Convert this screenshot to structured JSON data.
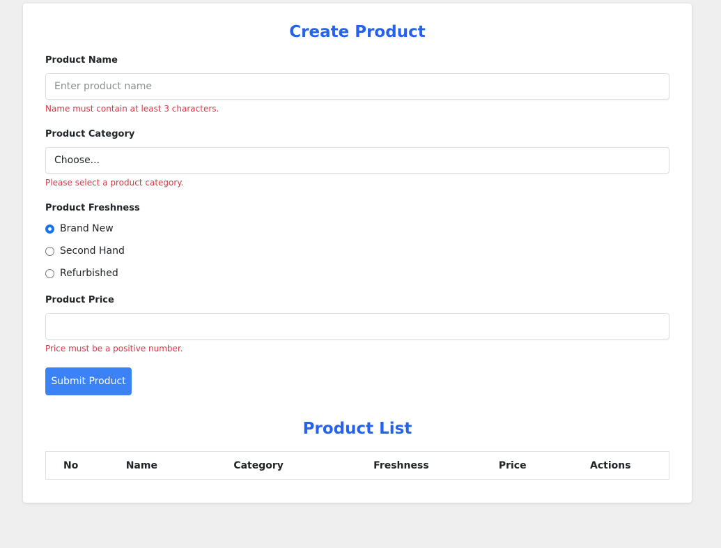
{
  "form": {
    "title": "Create Product",
    "name_label": "Product Name",
    "name_placeholder": "Enter product name",
    "name_value": "",
    "name_error": "Name must contain at least 3 characters.",
    "category_label": "Product Category",
    "category_selected": "Choose...",
    "category_error": "Please select a product category.",
    "freshness_label": "Product Freshness",
    "freshness_options": [
      {
        "label": "Brand New",
        "checked": true
      },
      {
        "label": "Second Hand",
        "checked": false
      },
      {
        "label": "Refurbished",
        "checked": false
      }
    ],
    "price_label": "Product Price",
    "price_value": "",
    "price_error": "Price must be a positive number.",
    "submit_label": "Submit Product"
  },
  "list": {
    "title": "Product List",
    "columns": [
      "No",
      "Name",
      "Category",
      "Freshness",
      "Price",
      "Actions"
    ],
    "rows": []
  },
  "colors": {
    "accent": "#2563eb",
    "button": "#3b82f6",
    "error": "#dc3545",
    "background": "#efefef"
  }
}
